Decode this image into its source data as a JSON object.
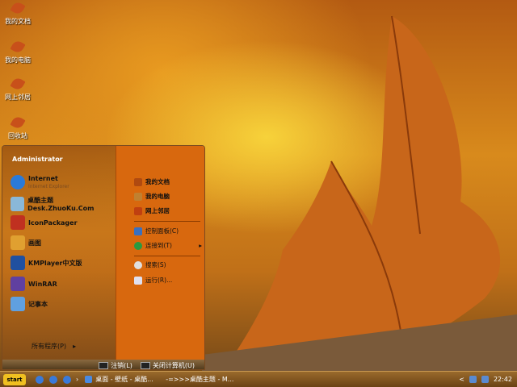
{
  "desktop_icons": [
    {
      "label": "我的文档"
    },
    {
      "label": "我的电脑"
    },
    {
      "label": "网上邻居"
    },
    {
      "label": "回收站"
    }
  ],
  "start_menu": {
    "user": "Administrator",
    "left_items": [
      {
        "label": "Internet",
        "sub": "Internet Explorer",
        "color": "#2a7ad8"
      },
      {
        "label": "桌酷主题Desk.ZhuoKu.Com",
        "color": "#8ab8d8"
      },
      {
        "label": "IconPackager",
        "color": "#c03020"
      },
      {
        "label": "画图",
        "color": "#e0a030"
      },
      {
        "label": "KMPlayer中文版",
        "color": "#2050a0"
      },
      {
        "label": "WinRAR",
        "color": "#6040a0"
      },
      {
        "label": "记事本",
        "color": "#60a0e0"
      }
    ],
    "all_programs": "所有程序(P)",
    "right_items": [
      {
        "label": "我的文档",
        "color": "#b04a10"
      },
      {
        "label": "我的电脑",
        "color": "#c08030"
      },
      {
        "label": "网上邻居",
        "color": "#c04010"
      },
      {
        "label": "控制面板(C)",
        "color": "#3a70c0"
      },
      {
        "label": "连接到(T)",
        "color": "#2a9a40"
      },
      {
        "label": "搜索(S)",
        "color": "#e0e0e0"
      },
      {
        "label": "运行(R)...",
        "color": "#e0e0f0"
      }
    ],
    "logoff": "注销(L)",
    "shutdown": "关闭计算机(U)"
  },
  "taskbar": {
    "start": "start",
    "tasks": [
      {
        "label": "桌面 - 壁纸 - 桌酷..."
      },
      {
        "label": "-=>>>桌酷主题 - M..."
      }
    ],
    "tray_arrow": "<",
    "clock": "22:42"
  }
}
